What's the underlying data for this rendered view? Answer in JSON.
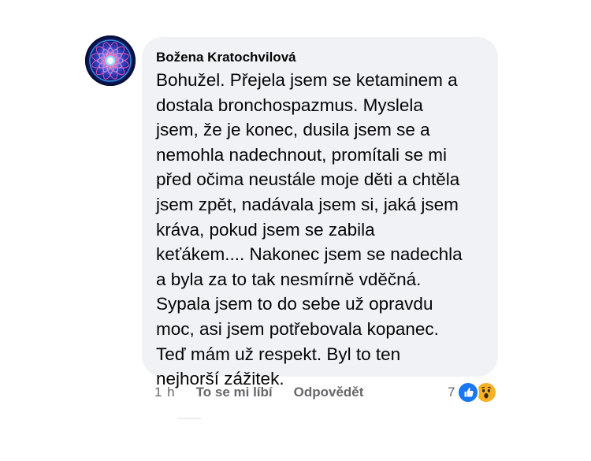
{
  "comment": {
    "author": "Božena Kratochvilová",
    "text": "Bohužel. Přejela jsem se ketaminem a\ndostala bronchospazmus. Myslela\njsem, že je konec, dusila jsem se a\nnemohla nadechnout, promítali se mi\npřed očima neustále moje děti a chtěla\njsem zpět, nadávala jsem si, jaká jsem\nkráva, pokud jsem se zabila\nkeťákem.... Nakonec jsem se nadechla\na byla za to tak nesmírně vděčná.\nSypala jsem to do sebe už opravdu\nmoc, asi jsem potřebovala kopanec.\nTeď mám už respekt. Byl to ten\nnejhorší zážitek."
  },
  "actions": {
    "time": "1 h",
    "like_label": "To se mi líbí",
    "reply_label": "Odpovědět"
  },
  "reactions": {
    "count": "7",
    "icons": [
      "like-icon",
      "wow-icon"
    ]
  },
  "colors": {
    "bubble": "#f0f2f5",
    "text": "#050505",
    "secondary_text": "#65676b",
    "like": "#1877f2",
    "wow": "#f7b125"
  }
}
